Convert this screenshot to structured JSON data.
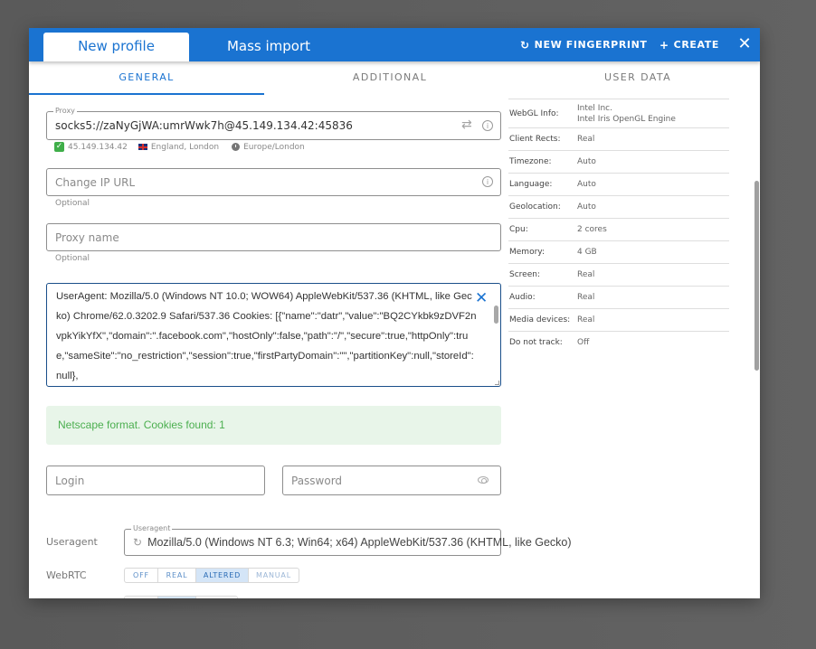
{
  "header": {
    "tabs": [
      {
        "label": "New profile",
        "active": true
      },
      {
        "label": "Mass import",
        "active": false
      }
    ],
    "new_fingerprint_label": "NEW FINGERPRINT",
    "create_label": "CREATE",
    "icons": {
      "fingerprint": "refresh-icon",
      "create": "plus-icon",
      "close": "close-icon"
    }
  },
  "subtabs": [
    {
      "label": "GENERAL",
      "active": true
    },
    {
      "label": "ADDITIONAL",
      "active": false
    },
    {
      "label": "USER DATA",
      "active": false
    }
  ],
  "proxy": {
    "legend": "Proxy",
    "value": "socks5://zaNyGjWA:umrWwk7h@45.149.134.42:45836",
    "status": {
      "ip": "45.149.134.42",
      "location": "England, London",
      "timezone": "Europe/London"
    }
  },
  "change_ip_url": {
    "placeholder": "Change IP URL",
    "hint": "Optional"
  },
  "proxy_name": {
    "placeholder": "Proxy name",
    "hint": "Optional"
  },
  "cookies_textarea": {
    "value": "UserAgent:    Mozilla/5.0 (Windows NT 10.0; WOW64) AppleWebKit/537.36 (KHTML, like Gecko) Chrome/62.0.3202.9 Safari/537.36   Cookies: [{\"name\":\"datr\",\"value\":\"BQ2CYkbk9zDVF2nvpkYikYfX\",\"domain\":\".facebook.com\",\"hostOnly\":false,\"path\":\"/\",\"secure\":true,\"httpOnly\":true,\"sameSite\":\"no_restriction\",\"session\":true,\"firstPartyDomain\":\"\",\"partitionKey\":null,\"storeId\":null},"
  },
  "alert": {
    "text": "Netscape format. Cookies found: 1",
    "color": "#4caf50"
  },
  "login": {
    "placeholder": "Login"
  },
  "password": {
    "placeholder": "Password"
  },
  "useragent": {
    "label": "Useragent",
    "legend": "Useragent",
    "value": "Mozilla/5.0 (Windows NT 6.3; Win64; x64) AppleWebKit/537.36 (KHTML, like Gecko)"
  },
  "webrtc": {
    "label": "WebRTC",
    "options": [
      "OFF",
      "REAL",
      "ALTERED",
      "MANUAL"
    ],
    "selected": "ALTERED"
  },
  "fingerprint_info": [
    {
      "key": "WebGL Info:",
      "value": "Intel Inc.",
      "value2": "Intel Iris OpenGL Engine"
    },
    {
      "key": "Client Rects:",
      "value": "Real"
    },
    {
      "key": "Timezone:",
      "value": "Auto"
    },
    {
      "key": "Language:",
      "value": "Auto"
    },
    {
      "key": "Geolocation:",
      "value": "Auto"
    },
    {
      "key": "Cpu:",
      "value": "2 cores"
    },
    {
      "key": "Memory:",
      "value": "4 GB"
    },
    {
      "key": "Screen:",
      "value": "Real"
    },
    {
      "key": "Audio:",
      "value": "Real"
    },
    {
      "key": "Media devices:",
      "value": "Real"
    },
    {
      "key": "Do not track:",
      "value": "Off"
    }
  ],
  "colors": {
    "accent": "#1a73d1",
    "success": "#4caf50",
    "success_bg": "#e8f5e9"
  }
}
